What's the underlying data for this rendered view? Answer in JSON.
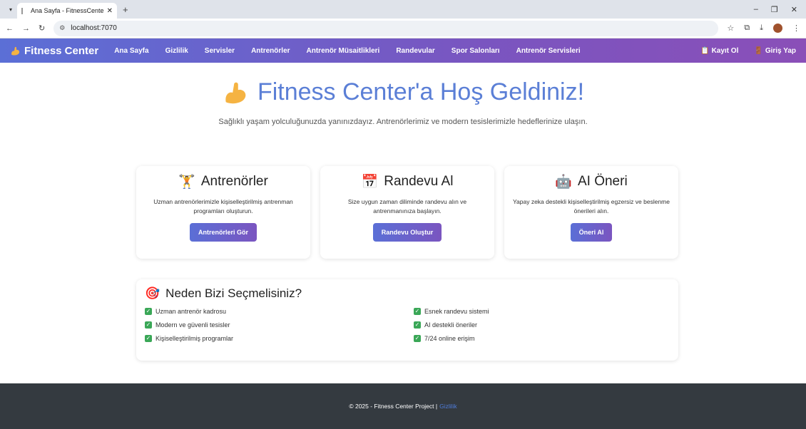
{
  "browser": {
    "tab_title": "Ana Sayfa - FitnessCenterProje",
    "url": "localhost:7070"
  },
  "navbar": {
    "brand": "Fitness Center",
    "links": [
      "Ana Sayfa",
      "Gizlilik",
      "Servisler",
      "Antrenörler",
      "Antrenör Müsaitlikleri",
      "Randevular",
      "Spor Salonları",
      "Antrenör Servisleri"
    ],
    "register": "Kayıt Ol",
    "login": "Giriş Yap"
  },
  "hero": {
    "title": "Fitness Center'a Hoş Geldiniz!",
    "subtitle": "Sağlıklı yaşam yolculuğunuzda yanınızdayız. Antrenörlerimiz ve modern tesislerimizle hedeflerinize ulaşın."
  },
  "cards": [
    {
      "title": "Antrenörler",
      "icon": "weightlifter-icon",
      "text": "Uzman antrenörlerimizle kişiselleştirilmiş antrenman programları oluşturun.",
      "button": "Antrenörleri Gör"
    },
    {
      "title": "Randevu Al",
      "icon": "calendar-icon",
      "text": "Size uygun zaman diliminde randevu alın ve antrenmanınıza başlayın.",
      "button": "Randevu Oluştur"
    },
    {
      "title": "AI Öneri",
      "icon": "robot-icon",
      "text": "Yapay zeka destekli kişiselleştirilmiş egzersiz ve beslenme önerileri alın.",
      "button": "Öneri Al"
    }
  ],
  "why": {
    "title": "Neden Bizi Seçmelisiniz?",
    "items": [
      "Uzman antrenör kadrosu",
      "Esnek randevu sistemi",
      "Modern ve güvenli tesisler",
      "AI destekli öneriler",
      "Kişiselleştirilmiş programlar",
      "7/24 online erişim"
    ]
  },
  "footer": {
    "text": "© 2025 - Fitness Center Project |",
    "link": "Gizlilik"
  },
  "colors": {
    "accent": "#5b7fd6",
    "nav_gradient_start": "#5b6fd6",
    "nav_gradient_end": "#8a4fb8",
    "footer_bg": "#343a40",
    "check": "#3aa757"
  }
}
